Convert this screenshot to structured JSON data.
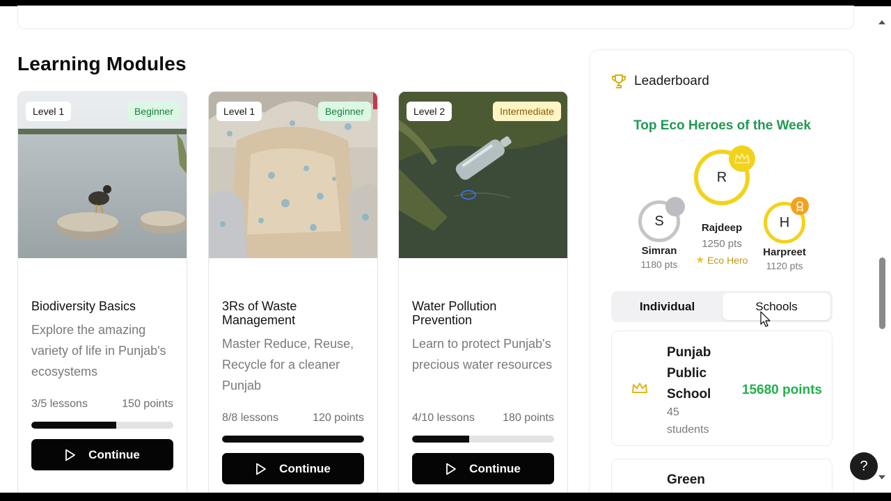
{
  "section_title": "Learning Modules",
  "modules": [
    {
      "level": "Level 1",
      "difficulty": "Beginner",
      "title": "Biodiversity Basics",
      "description": "Explore the amazing variety of life in Punjab's ecosystems",
      "lessons": "3/5 lessons",
      "points": "150 points",
      "progress": 0.6,
      "button": "Continue"
    },
    {
      "level": "Level 1",
      "difficulty": "Beginner",
      "title": "3Rs of Waste Management",
      "description": "Master Reduce, Reuse, Recycle for a cleaner Punjab",
      "lessons": "8/8 lessons",
      "points": "120 points",
      "progress": 1.0,
      "button": "Continue"
    },
    {
      "level": "Level 2",
      "difficulty": "Intermediate",
      "title": "Water Pollution Prevention",
      "description": "Learn to protect Punjab's precious water resources",
      "lessons": "4/10 lessons",
      "points": "180 points",
      "progress": 0.4,
      "button": "Continue"
    }
  ],
  "leaderboard": {
    "title": "Leaderboard",
    "subtitle": "Top Eco Heroes of the Week",
    "heroes": [
      {
        "initial": "S",
        "name": "Simran",
        "points": "1180 pts"
      },
      {
        "initial": "R",
        "name": "Rajdeep",
        "points": "1250 pts",
        "tag": "Eco Hero"
      },
      {
        "initial": "H",
        "name": "Harpreet",
        "points": "1120 pts"
      }
    ],
    "tabs": [
      "Individual",
      "Schools"
    ],
    "schools": [
      {
        "name": "Punjab Public School",
        "students": "45 students",
        "points": "15680 points"
      },
      {
        "name": "Green"
      }
    ]
  },
  "help": "?",
  "colors": {
    "accent_green": "#1f9a52",
    "points_green": "#22b04c",
    "gold": "#f2d31b",
    "button_black": "#050505"
  }
}
